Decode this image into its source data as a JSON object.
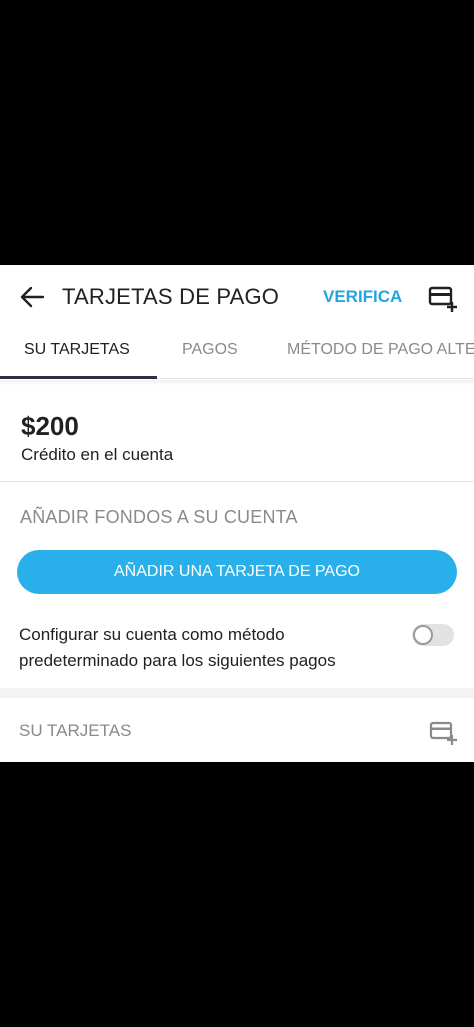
{
  "header": {
    "title": "TARJETAS DE PAGO",
    "verify_label": "VERIFICA",
    "back_icon": "arrow-left-icon",
    "add_card_icon": "card-plus-icon"
  },
  "tabs": [
    {
      "label": "SU TARJETAS",
      "active": true
    },
    {
      "label": "PAGOS",
      "active": false
    },
    {
      "label": "MÉTODO DE PAGO ALTE",
      "active": false
    }
  ],
  "credit": {
    "amount": "$200",
    "label": "Crédito en el cuenta"
  },
  "funds": {
    "section_label": "AÑADIR FONDOS A SU CUENTA",
    "add_card_button": "AÑADIR UNA TARJETA DE PAGO"
  },
  "default_payment": {
    "text": "Configurar su cuenta como método predeterminado para los siguientes pagos",
    "enabled": false
  },
  "cards_section": {
    "label": "SU TARJETAS",
    "icon": "card-plus-icon"
  },
  "colors": {
    "accent": "#29b0eb",
    "verify": "#22a6dd",
    "text": "#202124",
    "muted": "#8a8a8a"
  }
}
